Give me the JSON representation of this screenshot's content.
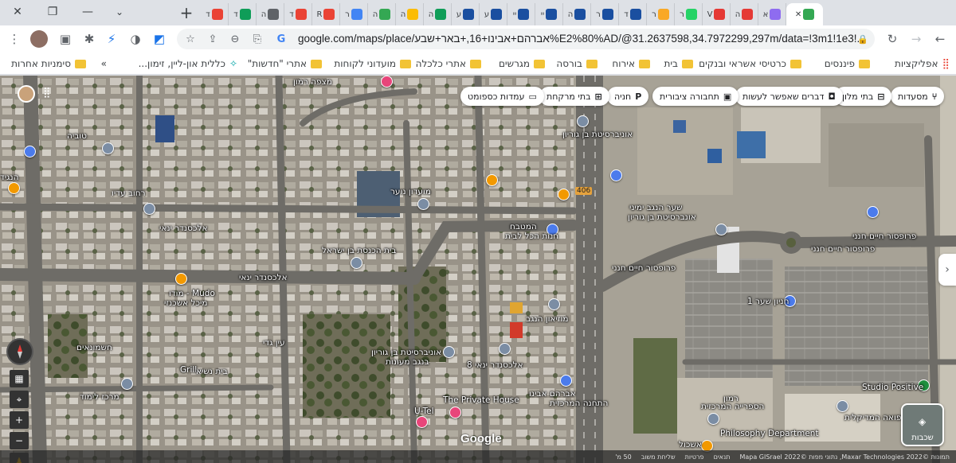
{
  "browser": {
    "tabs": [
      {
        "letter": "ד",
        "icon": "gmail-icon",
        "color": "#ea4335",
        "active": false
      },
      {
        "letter": "ד",
        "icon": "sheets-icon",
        "color": "#0f9d58",
        "active": false
      },
      {
        "letter": "ה",
        "icon": "app-icon",
        "color": "#5f6368",
        "active": false
      },
      {
        "letter": "ד",
        "icon": "gmail-icon",
        "color": "#ea4335",
        "active": false
      },
      {
        "letter": "R",
        "icon": "gmail-icon",
        "color": "#ea4335",
        "active": false
      },
      {
        "letter": "ר",
        "icon": "drive-icon",
        "color": "#4285f4",
        "active": false
      },
      {
        "letter": "ה",
        "icon": "drive-icon",
        "color": "#34a853",
        "active": false
      },
      {
        "letter": "ה",
        "icon": "drive-icon",
        "color": "#fbbc04",
        "active": false
      },
      {
        "letter": "ה",
        "icon": "sheets-icon",
        "color": "#0f9d58",
        "active": false
      },
      {
        "letter": "ע",
        "icon": "b-icon",
        "color": "#1a4fa0",
        "active": false
      },
      {
        "letter": "ע",
        "icon": "b-icon",
        "color": "#1a4fa0",
        "active": false
      },
      {
        "letter": "יי",
        "icon": "b-icon",
        "color": "#1a4fa0",
        "active": false
      },
      {
        "letter": "יי",
        "icon": "b-icon",
        "color": "#1a4fa0",
        "active": false
      },
      {
        "letter": "ה",
        "icon": "b-icon",
        "color": "#1a4fa0",
        "active": false
      },
      {
        "letter": "ר",
        "icon": "b-icon",
        "color": "#1a4fa0",
        "active": false
      },
      {
        "letter": "ד",
        "icon": "b-icon",
        "color": "#1a4fa0",
        "active": false
      },
      {
        "letter": "ר",
        "icon": "app-icon",
        "color": "#f9a825",
        "active": false
      },
      {
        "letter": "ר",
        "icon": "whatsapp-icon",
        "color": "#25d366",
        "active": false
      },
      {
        "letter": "V",
        "icon": "app-icon",
        "color": "#e53935",
        "active": false
      },
      {
        "letter": "ה",
        "icon": "app-icon",
        "color": "#e53935",
        "active": false
      },
      {
        "letter": "א",
        "icon": "telegram-icon",
        "color": "#8e6cf0",
        "active": false
      },
      {
        "letter": "",
        "icon": "maps-icon",
        "color": "#34a853",
        "active": true
      }
    ],
    "url": "google.com/maps/place/אברהם+אבינו+16,+באר+שבע%E2%80%AD/@31.2637598,34.7972299,297m/data=!3m1!1e3!..."
  },
  "bookmarks": {
    "apps": "אפליקציות",
    "items": [
      "פיננסים",
      "כרטיסי אשראי ובנקים",
      "בית",
      "אירוח",
      "בורסה",
      "מגרשים",
      "אתרי כלכלה",
      "מועדוני לקוחות",
      "אתרי \"חדשות\"",
      "כללית און-ליין, זימון..."
    ],
    "more": "»",
    "other": "סימניות אחרות"
  },
  "map": {
    "chips": [
      {
        "label": "מסעדות",
        "icon": "restaurant-icon"
      },
      {
        "label": "בתי מלון",
        "icon": "hotel-icon"
      },
      {
        "label": "דברים שאפשר לעשות",
        "icon": "camera-icon"
      },
      {
        "label": "תחבורה ציבורית",
        "icon": "transit-icon"
      },
      {
        "label": "חניה",
        "icon": "parking-icon"
      },
      {
        "label": "בתי מרקחת",
        "icon": "pharmacy-icon"
      },
      {
        "label": "עמדות כספומט",
        "icon": "atm-icon"
      }
    ],
    "labels": {
      "uni": "אוניברסיטת בן גוריון",
      "yemin": "שער הנגב ימיני",
      "yemin2": "אונברסיטת בן גוריון",
      "pro": "פרופסור חיים חנני",
      "pro2": "פרופסור חיים חנני",
      "pro3": "פרופסור חיים חנני",
      "youth": "מועדון נוער",
      "hamitbach": "המטבח",
      "kitchen": "חנות הכל לבית",
      "yanai": "אלכסנדר ינאי",
      "mudo": "Mudo - מודו",
      "mudo2": "מיכל אשכנזי",
      "grill": "Grill",
      "kinder": "בית הכנסת בן ישראל",
      "uni2": "אוניברסיטת בן גוריון",
      "uni3": "בנגב מעונות",
      "yanai2": "אלכסנדר ינאי 8",
      "private": "The Private House",
      "utel": "U-Tel",
      "teaching": "מרכז לימוד",
      "museum": "מוזיאון הנגב",
      "gate1": "חניון שער 1",
      "studio": "Studio Positive",
      "philo": "Philosophy Department",
      "library": "הספרייה המרכזית",
      "research": "הרפואה המדיקלית",
      "eshkol": "אשכול",
      "avraham": "אברהם אבינו",
      "hashmal": "חשמונאים",
      "yanai3": "אלכסנדר ינאי",
      "road406": "406",
      "tuvia": "טוביה",
      "hanagid": "הנגיד",
      "bennasi": "בית נשיא",
      "station": "התחנה המרכזית",
      "mitspe": "מצפה רמון",
      "ashkenazi": "רחוב עדיו",
      "ramon": "רמון",
      "ein": "עין גדי"
    },
    "layers_label": "שכבות",
    "google": "Google",
    "footer": [
      "תמונות ©2022 Maxar Technologies, נתוני מפות ©2022 Mapa GISrael",
      "תנאים",
      "פרטיות",
      "שליחת משוב",
      "50 מ'"
    ]
  }
}
